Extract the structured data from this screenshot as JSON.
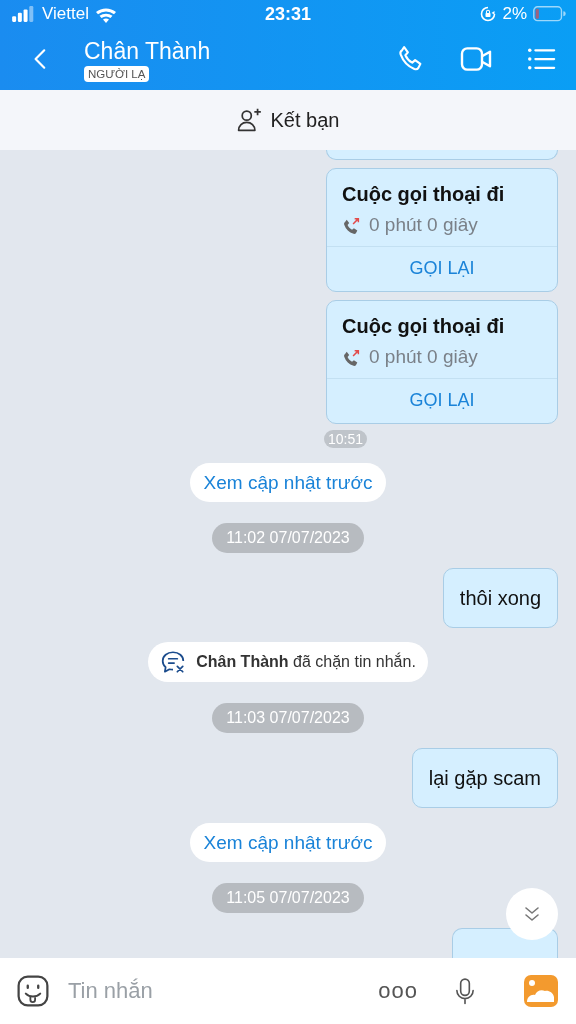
{
  "status_bar": {
    "carrier": "Viettel",
    "time": "23:31",
    "battery": "2%"
  },
  "header": {
    "title": "Chân Thành",
    "badge": "NGƯỜI LẠ"
  },
  "add_friend": {
    "label": "Kết bạn"
  },
  "messages": [
    {
      "kind": "call_card",
      "cut": true
    },
    {
      "kind": "call_card",
      "title": "Cuộc gọi thoại đi",
      "duration": "0 phút 0 giây",
      "action": "GỌI LẠI"
    },
    {
      "kind": "call_card",
      "title": "Cuộc gọi thoại đi",
      "duration": "0 phút 0 giây",
      "action": "GỌI LẠI"
    },
    {
      "kind": "time",
      "text": "10:51"
    },
    {
      "kind": "load_more",
      "text": "Xem cập nhật trước"
    },
    {
      "kind": "date",
      "text": "11:02 07/07/2023"
    },
    {
      "kind": "text",
      "text": "thôi xong"
    },
    {
      "kind": "system",
      "text": "**Chân Thành** đã chặn tin nhắn."
    },
    {
      "kind": "date",
      "text": "11:03 07/07/2023"
    },
    {
      "kind": "text",
      "text": "lại gặp scam"
    },
    {
      "kind": "load_more",
      "text": "Xem cập nhật trước"
    },
    {
      "kind": "date",
      "text": "11:05 07/07/2023"
    },
    {
      "kind": "text",
      "cut": true
    }
  ],
  "composer": {
    "placeholder": "Tin nhắn",
    "more": "ooo"
  }
}
